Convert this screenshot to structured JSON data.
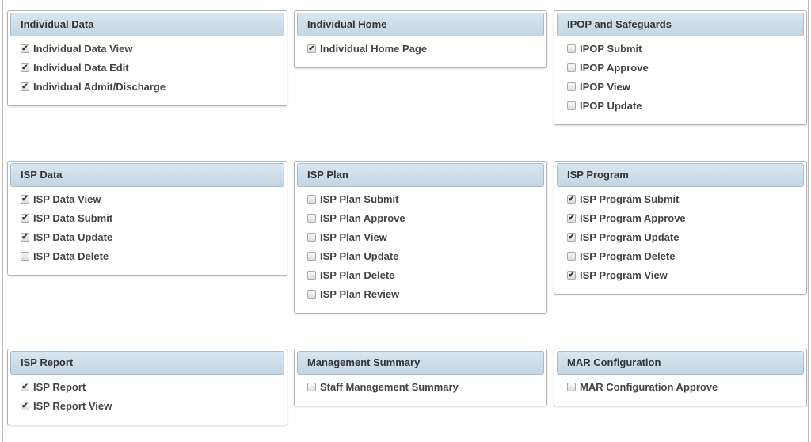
{
  "panels": [
    {
      "title": "Individual Data",
      "items": [
        {
          "label": "Individual Data View",
          "checked": true
        },
        {
          "label": "Individual Data Edit",
          "checked": true
        },
        {
          "label": "Individual Admit/Discharge",
          "checked": true
        }
      ]
    },
    {
      "title": "Individual Home",
      "items": [
        {
          "label": "Individual Home Page",
          "checked": true
        }
      ]
    },
    {
      "title": "IPOP and Safeguards",
      "items": [
        {
          "label": "IPOP Submit",
          "checked": false
        },
        {
          "label": "IPOP Approve",
          "checked": false
        },
        {
          "label": "IPOP View",
          "checked": false
        },
        {
          "label": "IPOP Update",
          "checked": false
        }
      ]
    },
    {
      "title": "ISP Data",
      "items": [
        {
          "label": "ISP Data View",
          "checked": true
        },
        {
          "label": "ISP Data Submit",
          "checked": true
        },
        {
          "label": "ISP Data Update",
          "checked": true
        },
        {
          "label": "ISP Data Delete",
          "checked": false
        }
      ]
    },
    {
      "title": "ISP Plan",
      "items": [
        {
          "label": "ISP Plan Submit",
          "checked": false
        },
        {
          "label": "ISP Plan Approve",
          "checked": false
        },
        {
          "label": "ISP Plan View",
          "checked": false
        },
        {
          "label": "ISP Plan Update",
          "checked": false
        },
        {
          "label": "ISP Plan Delete",
          "checked": false
        },
        {
          "label": "ISP Plan Review",
          "checked": false
        }
      ]
    },
    {
      "title": "ISP Program",
      "items": [
        {
          "label": "ISP Program Submit",
          "checked": true
        },
        {
          "label": "ISP Program Approve",
          "checked": true
        },
        {
          "label": "ISP Program Update",
          "checked": true
        },
        {
          "label": "ISP Program Delete",
          "checked": false
        },
        {
          "label": "ISP Program View",
          "checked": true
        }
      ]
    },
    {
      "title": "ISP Report",
      "items": [
        {
          "label": "ISP Report",
          "checked": true
        },
        {
          "label": "ISP Report View",
          "checked": true
        }
      ]
    },
    {
      "title": "Management Summary",
      "items": [
        {
          "label": "Staff Management Summary",
          "checked": false
        }
      ]
    },
    {
      "title": "MAR Configuration",
      "items": [
        {
          "label": "MAR Configuration Approve",
          "checked": false
        }
      ]
    }
  ]
}
